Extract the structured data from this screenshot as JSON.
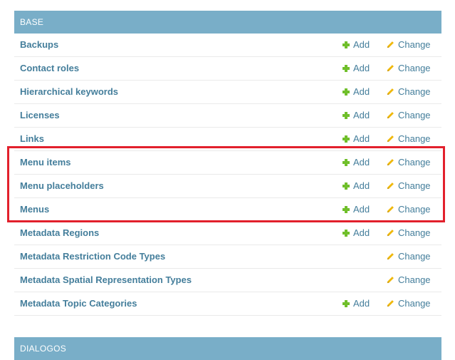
{
  "modules": [
    {
      "caption": "BASE",
      "rows": [
        {
          "name": "Backups",
          "add": "Add",
          "change": "Change",
          "has_add": true
        },
        {
          "name": "Contact roles",
          "add": "Add",
          "change": "Change",
          "has_add": true
        },
        {
          "name": "Hierarchical keywords",
          "add": "Add",
          "change": "Change",
          "has_add": true
        },
        {
          "name": "Licenses",
          "add": "Add",
          "change": "Change",
          "has_add": true
        },
        {
          "name": "Links",
          "add": "Add",
          "change": "Change",
          "has_add": true
        },
        {
          "name": "Menu items",
          "add": "Add",
          "change": "Change",
          "has_add": true
        },
        {
          "name": "Menu placeholders",
          "add": "Add",
          "change": "Change",
          "has_add": true
        },
        {
          "name": "Menus",
          "add": "Add",
          "change": "Change",
          "has_add": true
        },
        {
          "name": "Metadata Regions",
          "add": "Add",
          "change": "Change",
          "has_add": true
        },
        {
          "name": "Metadata Restriction Code Types",
          "add": "",
          "change": "Change",
          "has_add": false
        },
        {
          "name": "Metadata Spatial Representation Types",
          "add": "",
          "change": "Change",
          "has_add": false
        },
        {
          "name": "Metadata Topic Categories",
          "add": "Add",
          "change": "Change",
          "has_add": true
        }
      ]
    },
    {
      "caption": "DIALOGOS",
      "rows": []
    }
  ],
  "colors": {
    "caption_bg": "#79aec8",
    "link": "#447e9b",
    "add_icon": "#70bf2b",
    "change_icon": "#efb80b",
    "highlight": "#e2202c"
  },
  "icons": {
    "add": "plus-icon",
    "change": "pencil-icon"
  }
}
